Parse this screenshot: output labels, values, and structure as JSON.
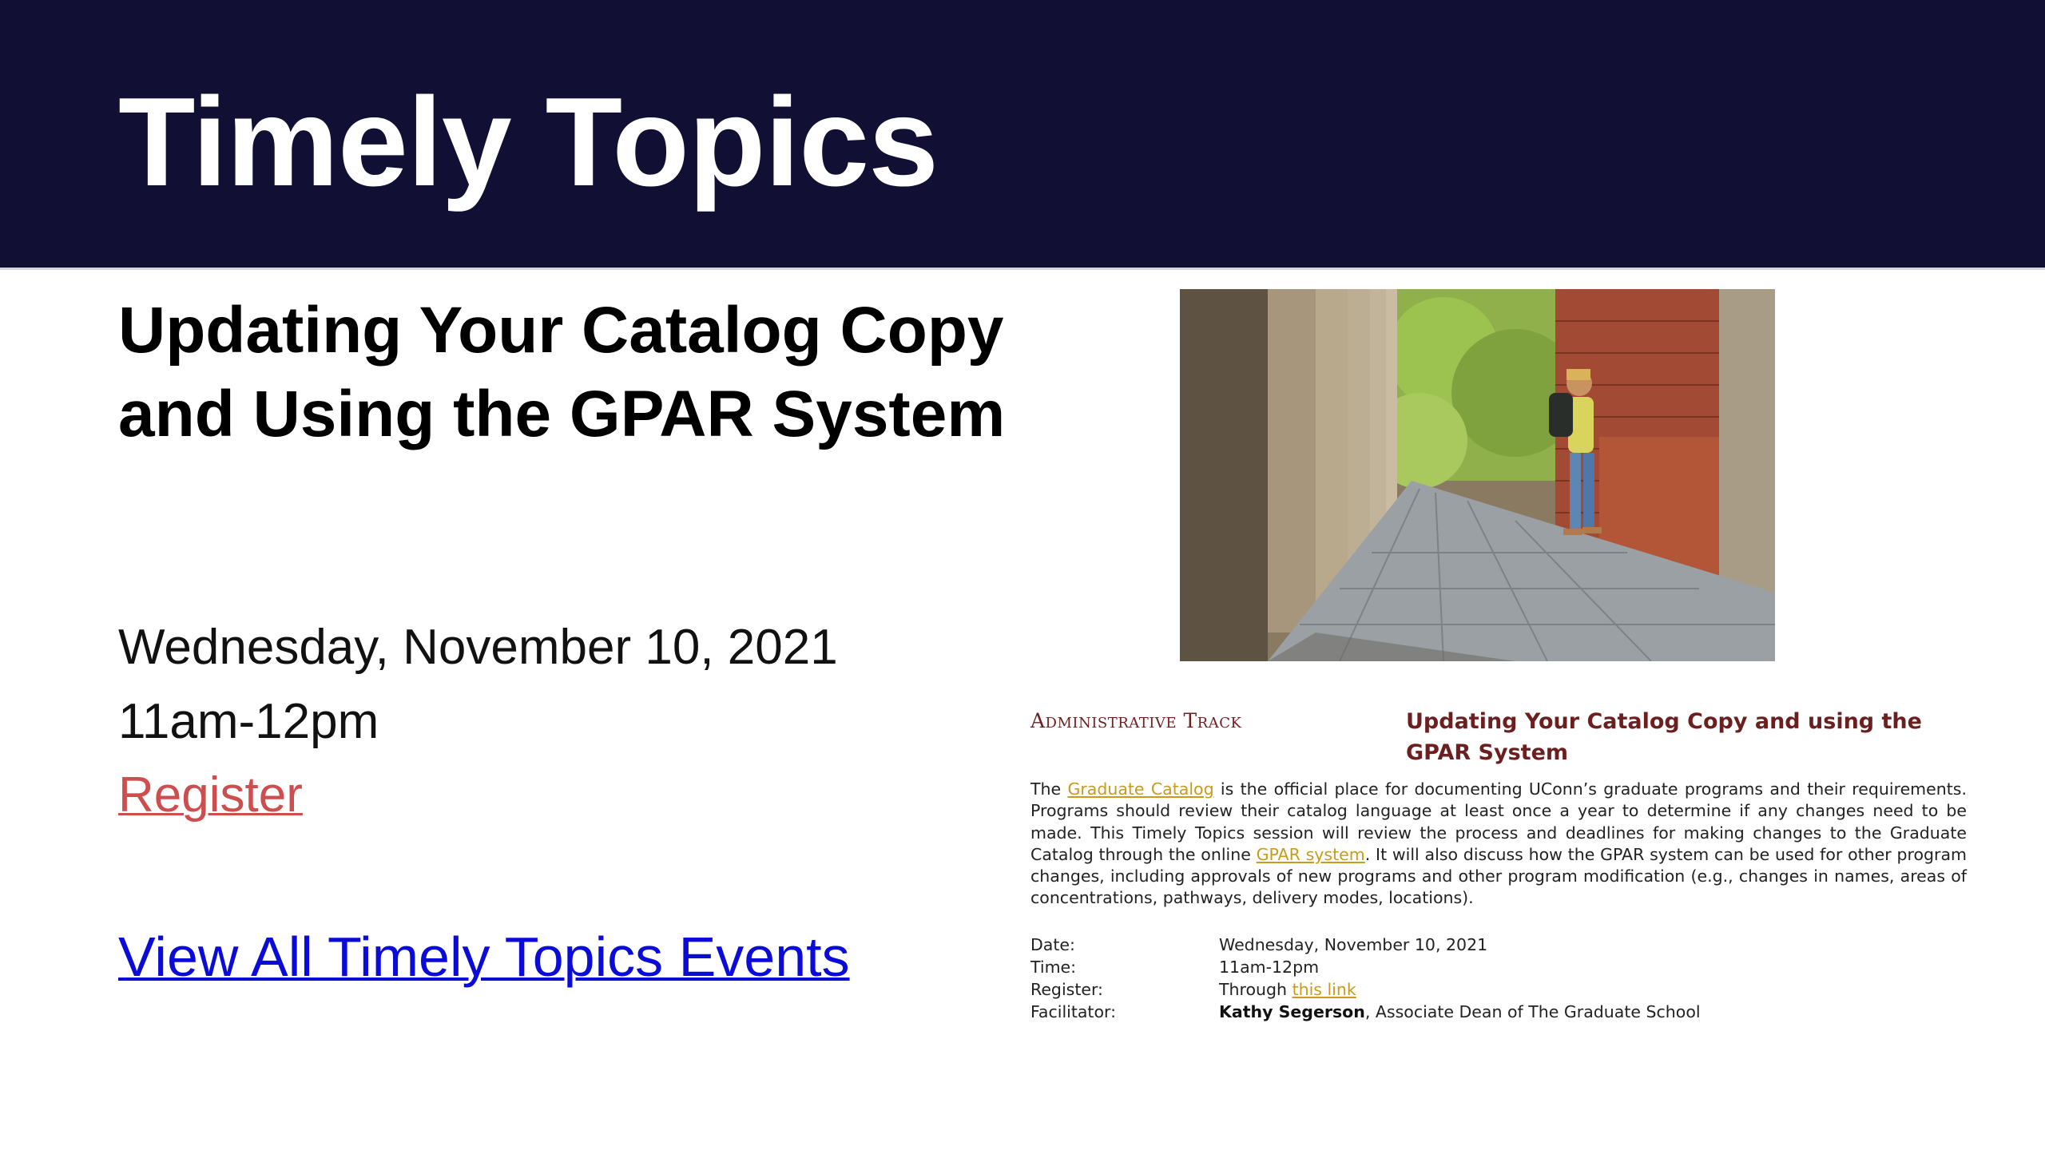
{
  "header": {
    "title": "Timely Topics",
    "bg_color": "#110f33"
  },
  "session": {
    "title": "Updating Your Catalog Copy and Using the GPAR System",
    "date": "Wednesday, November 10, 2021",
    "time": "11am-12pm",
    "register_label": "Register",
    "register_color": "#cc4e4e"
  },
  "view_all_label": "View All Timely Topics Events",
  "flyer": {
    "track": "Administrative Track",
    "title": "Updating Your Catalog Copy and using the GPAR System",
    "body": {
      "p1": "The ",
      "link1": "Graduate Catalog",
      "p2": " is the official place for documenting UConn’s graduate programs and their requirements.  Programs should review their catalog language at least once a year to determine if any changes need to be made.  This Timely Topics session will review the process and deadlines for making changes to the Graduate Catalog through the online ",
      "link2": "GPAR system",
      "p3": ".  It will also discuss how the GPAR system can be used for other program changes, including approvals of new programs and other program modification (e.g., changes in names, areas of concentrations, pathways, delivery modes, locations)."
    },
    "details": {
      "date_label": "Date:",
      "date_value": "Wednesday, November 10, 2021",
      "time_label": "Time:",
      "time_value": "11am-12pm",
      "register_label": "Register:",
      "register_prefix": "Through ",
      "register_link": "this link",
      "facilitator_label": "Facilitator:",
      "facilitator_name": "Kathy Segerson",
      "facilitator_role": ", Associate Dean of The Graduate School"
    },
    "link_color": "#c99a1b",
    "title_color": "#6b1f1f"
  }
}
